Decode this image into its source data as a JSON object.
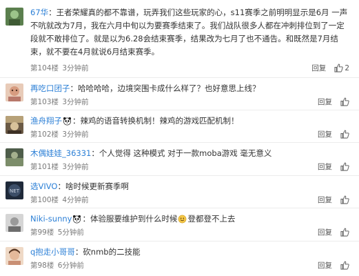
{
  "comments": [
    {
      "username": "67华",
      "sep": "：",
      "content": "王者荣耀真的都不靠谱，玩弄我们这些玩家的心，s11赛季之前明明显示是6月 一声不吭就改为7月，我在六月中旬以为要赛季结束了。我们战队很多人都在冲刺排位到了一定段就不敢排位了。就是以为6.28会结束赛季，结果改为七月了也不通告。和既然是7月结束，就不要在4月就说6月结束赛季。",
      "floor": "第104楼",
      "time": "3分钟前",
      "reply": "回复",
      "likes": "2",
      "avatar_color": "#7aa86a"
    },
    {
      "username": "再吃口团子",
      "sep": "：",
      "content": "哈哈哈哈，边境突围卡成什么样了？也好意思上线？",
      "floor": "第103楼",
      "time": "3分钟前",
      "reply": "回复",
      "likes": "",
      "avatar_color": "#d9a98f"
    },
    {
      "username": "渔舟翔子",
      "sep": "：",
      "content": "辣鸡的语音转换机制！辣鸡的游戏匹配机制！",
      "floor": "第102楼",
      "time": "3分钟前",
      "reply": "回复",
      "likes": "",
      "avatar_color": "#a88f6b"
    },
    {
      "username": "木偶娃娃_36331",
      "sep": "：",
      "content": "个人觉得 这种模式 对于一款moba游戏 毫无意义",
      "floor": "第101楼",
      "time": "3分钟前",
      "reply": "回复",
      "likes": "",
      "avatar_color": "#6e7f6a"
    },
    {
      "username": "选VIVO",
      "sep": "：",
      "content": "啥时候更新赛季啊",
      "floor": "第100楼",
      "time": "4分钟前",
      "reply": "回复",
      "likes": "",
      "avatar_color": "#2f3b4d"
    },
    {
      "username": "Niki-sunny",
      "sep": "：",
      "content_before": "体验服要维护到什么时候",
      "content_after": "登都登不上去",
      "floor": "第99楼",
      "time": "5分钟前",
      "reply": "回复",
      "likes": "",
      "avatar_color": "#8a8a8a"
    },
    {
      "username": "q抱走小哥哥",
      "sep": "：",
      "content": "砍nmb的二技能",
      "floor": "第98楼",
      "time": "6分钟前",
      "reply": "回复",
      "likes": "",
      "avatar_color": "#c9a58c"
    }
  ],
  "colors": {
    "username": "#2b7fd6",
    "meta": "#7a7a7a",
    "divider": "#ececec"
  },
  "icons": {
    "like": "thumbs-up-icon",
    "panda": "panda-emoji-icon",
    "smile": "smile-emoji-icon"
  }
}
